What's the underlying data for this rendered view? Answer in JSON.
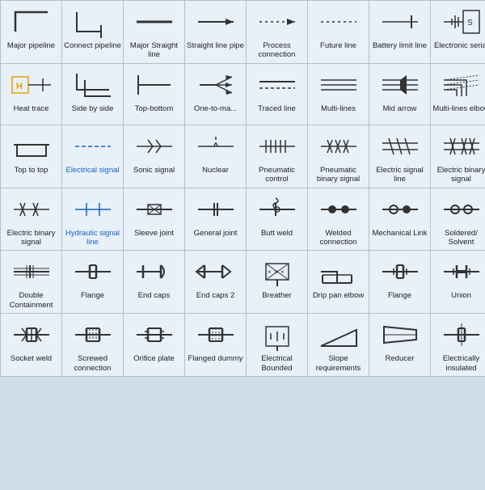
{
  "cells": [
    {
      "id": "major-pipeline",
      "label": "Major\npipeline",
      "blue": false
    },
    {
      "id": "connect-pipeline",
      "label": "Connect\npipeline",
      "blue": false
    },
    {
      "id": "major-straight-line",
      "label": "Major\nStraight line",
      "blue": false
    },
    {
      "id": "straight-line-pipe",
      "label": "Straight line\npipe",
      "blue": false
    },
    {
      "id": "process-connection",
      "label": "Process\nconnection",
      "blue": false
    },
    {
      "id": "future-line",
      "label": "Future line",
      "blue": false
    },
    {
      "id": "battery-limit-line",
      "label": "Battery limit\nline",
      "blue": false
    },
    {
      "id": "electronic-serial",
      "label": "Electronic\nserial",
      "blue": false
    },
    {
      "id": "heat-trace",
      "label": "Heat trace",
      "blue": false
    },
    {
      "id": "side-by-side",
      "label": "Side by side",
      "blue": false
    },
    {
      "id": "top-bottom",
      "label": "Top-bottom",
      "blue": false
    },
    {
      "id": "one-to-many",
      "label": "One-to-ma...",
      "blue": false
    },
    {
      "id": "traced-line",
      "label": "Traced line",
      "blue": false
    },
    {
      "id": "multi-lines",
      "label": "Multi-lines",
      "blue": false
    },
    {
      "id": "mid-arrow",
      "label": "Mid arrow",
      "blue": false
    },
    {
      "id": "multi-lines-elbow",
      "label": "Multi-lines\nelbow",
      "blue": false
    },
    {
      "id": "top-to-top",
      "label": "Top to top",
      "blue": false
    },
    {
      "id": "electrical-signal",
      "label": "Electrical\nsignal",
      "blue": true
    },
    {
      "id": "sonic-signal",
      "label": "Sonic signal",
      "blue": false
    },
    {
      "id": "nuclear",
      "label": "Nuclear",
      "blue": false
    },
    {
      "id": "pneumatic-control",
      "label": "Pneumatic\ncontrol",
      "blue": false
    },
    {
      "id": "pneumatic-binary-signal",
      "label": "Pneumatic\nbinary signal",
      "blue": false
    },
    {
      "id": "electric-signal-line",
      "label": "Electric\nsignal line",
      "blue": false
    },
    {
      "id": "electric-binary-signal",
      "label": "Electric\nbinary signal",
      "blue": false
    },
    {
      "id": "electric-binary-signal2",
      "label": "Electric\nbinary signal",
      "blue": false
    },
    {
      "id": "hydraulic-signal-line",
      "label": "Hydraulic\nsignal line",
      "blue": true
    },
    {
      "id": "sleeve-joint",
      "label": "Sleeve joint",
      "blue": false
    },
    {
      "id": "general-joint",
      "label": "General joint",
      "blue": false
    },
    {
      "id": "butt-weld",
      "label": "Butt weld",
      "blue": false
    },
    {
      "id": "welded-connection",
      "label": "Welded\nconnection",
      "blue": false
    },
    {
      "id": "mechanical-link",
      "label": "Mechanical\nLink",
      "blue": false
    },
    {
      "id": "soldered-solvent",
      "label": "Soldered/\nSolvent",
      "blue": false
    },
    {
      "id": "double-containment",
      "label": "Double\nContainment",
      "blue": false
    },
    {
      "id": "flange",
      "label": "Flange",
      "blue": false
    },
    {
      "id": "end-caps",
      "label": "End caps",
      "blue": false
    },
    {
      "id": "end-caps-2",
      "label": "End caps 2",
      "blue": false
    },
    {
      "id": "breather",
      "label": "Breather",
      "blue": false
    },
    {
      "id": "drip-pan-elbow",
      "label": "Drip pan\nelbow",
      "blue": false
    },
    {
      "id": "flange2",
      "label": "Flange",
      "blue": false
    },
    {
      "id": "union",
      "label": "Union",
      "blue": false
    },
    {
      "id": "socket-weld",
      "label": "Socket weld",
      "blue": false
    },
    {
      "id": "screwed-connection",
      "label": "Screwed\nconnection",
      "blue": false
    },
    {
      "id": "orifice-plate",
      "label": "Orifice plate",
      "blue": false
    },
    {
      "id": "flanged-dummy",
      "label": "Flanged\ndummy",
      "blue": false
    },
    {
      "id": "electrical-bounded",
      "label": "Electrical\nBounded",
      "blue": false
    },
    {
      "id": "slope-requirements",
      "label": "Slope\nrequirements",
      "blue": false
    },
    {
      "id": "reducer",
      "label": "Reducer",
      "blue": false
    },
    {
      "id": "electrically-insulated",
      "label": "Electrically\ninsulated",
      "blue": false
    }
  ]
}
